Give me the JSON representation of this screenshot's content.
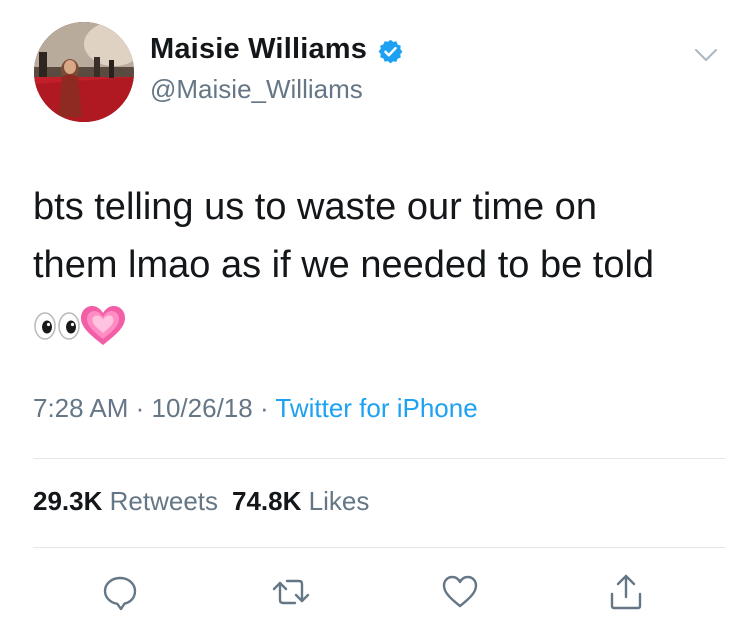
{
  "tweet": {
    "author": {
      "display_name": "Maisie Williams",
      "handle": "@Maisie_Williams",
      "verified": true
    },
    "text_lines": [
      "bts telling us to waste our time on",
      "them lmao as if we needed to be told"
    ],
    "emojis": [
      "eyes-emoji",
      "growing-heart-emoji"
    ],
    "time": "7:28 AM",
    "date": "10/26/18",
    "separator": " · ",
    "source": "Twitter for iPhone",
    "retweets": {
      "count": "29.3K",
      "label": "Retweets"
    },
    "likes": {
      "count": "74.8K",
      "label": "Likes"
    }
  },
  "icons": {
    "verified": "verified-badge-icon",
    "menu": "chevron-down-icon",
    "reply": "reply-icon",
    "retweet": "retweet-icon",
    "like": "heart-icon",
    "share": "share-icon"
  },
  "colors": {
    "text": "#14171a",
    "secondary": "#657786",
    "link": "#1da1f2",
    "verified": "#1da1f2",
    "divider": "#e1e8ed"
  }
}
